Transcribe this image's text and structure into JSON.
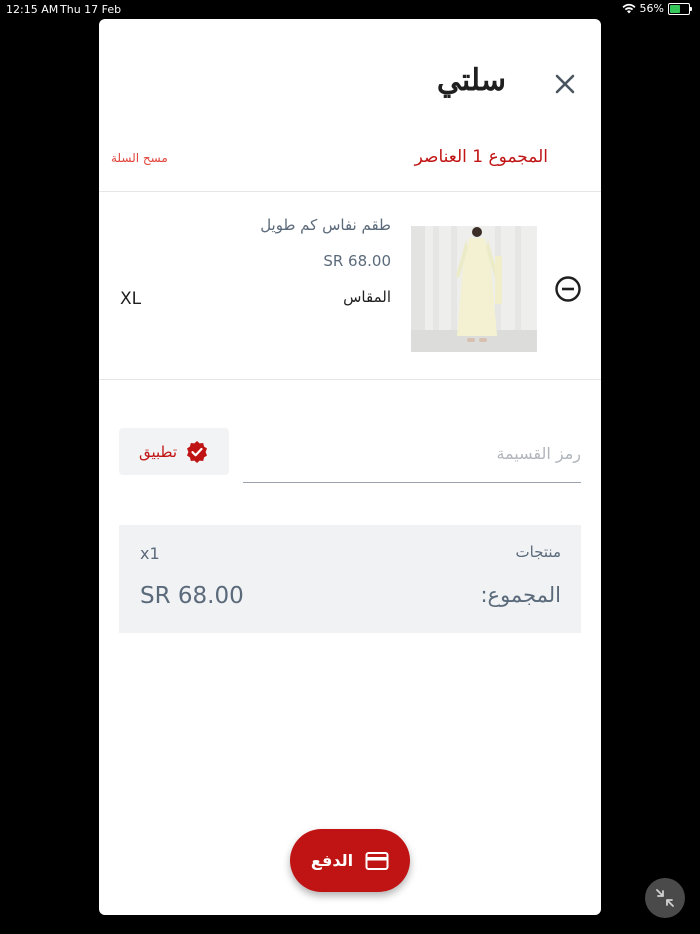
{
  "status_bar": {
    "time": "12:15 AM",
    "date": "Thu 17 Feb",
    "battery_percent": "56%",
    "battery_level": 0.56
  },
  "cart": {
    "title": "سلتي",
    "total_items_label": "المجموع 1 العناصر",
    "clear_label": "مسح السلة",
    "close_icon": "close-icon"
  },
  "item": {
    "name": "طقم نفاس كم طويل",
    "price": "SR 68.00",
    "size_label": "المقاس",
    "size_value": "XL",
    "image_icon": "product-photo",
    "remove_icon": "remove-circle-icon"
  },
  "coupon": {
    "placeholder": "رمز القسيمة",
    "value": "",
    "apply_label": "تطبيق",
    "apply_icon": "verified-check-icon"
  },
  "summary": {
    "products_label": "منتجات",
    "quantity": "x1",
    "total_label": "المجموع:",
    "total_value": "SR 68.00"
  },
  "checkout": {
    "pay_label": "الدفع",
    "pay_icon": "credit-card-icon"
  },
  "colors": {
    "accent": "#c01414",
    "text_muted": "#5b6a7a",
    "summary_bg": "#f0f2f4"
  }
}
